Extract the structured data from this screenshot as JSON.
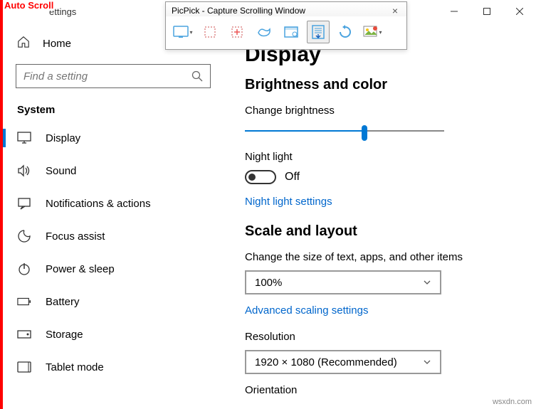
{
  "overlay": {
    "auto_scroll": "Auto Scroll"
  },
  "window": {
    "title": "ettings"
  },
  "picpick": {
    "title": "PicPick - Capture Scrolling Window",
    "tools": [
      "fullscreen",
      "region",
      "fixed-region",
      "freehand",
      "window",
      "scrolling-window",
      "repeat",
      "image-edit"
    ]
  },
  "sidebar": {
    "home": "Home",
    "search_placeholder": "Find a setting",
    "section": "System",
    "items": [
      {
        "label": "Display",
        "icon": "display"
      },
      {
        "label": "Sound",
        "icon": "sound"
      },
      {
        "label": "Notifications & actions",
        "icon": "notifications"
      },
      {
        "label": "Focus assist",
        "icon": "focus"
      },
      {
        "label": "Power & sleep",
        "icon": "power"
      },
      {
        "label": "Battery",
        "icon": "battery"
      },
      {
        "label": "Storage",
        "icon": "storage"
      },
      {
        "label": "Tablet mode",
        "icon": "tablet"
      }
    ]
  },
  "content": {
    "page_title": "Display",
    "brightness_section": "Brightness and color",
    "brightness_label": "Change brightness",
    "brightness_pct": 60,
    "night_light_label": "Night light",
    "night_light_state": "Off",
    "night_light_link": "Night light settings",
    "scale_section": "Scale and layout",
    "scale_label": "Change the size of text, apps, and other items",
    "scale_value": "100%",
    "scale_link": "Advanced scaling settings",
    "resolution_label": "Resolution",
    "resolution_value": "1920 × 1080 (Recommended)",
    "orientation_label": "Orientation"
  },
  "watermark": "wsxdn.com"
}
